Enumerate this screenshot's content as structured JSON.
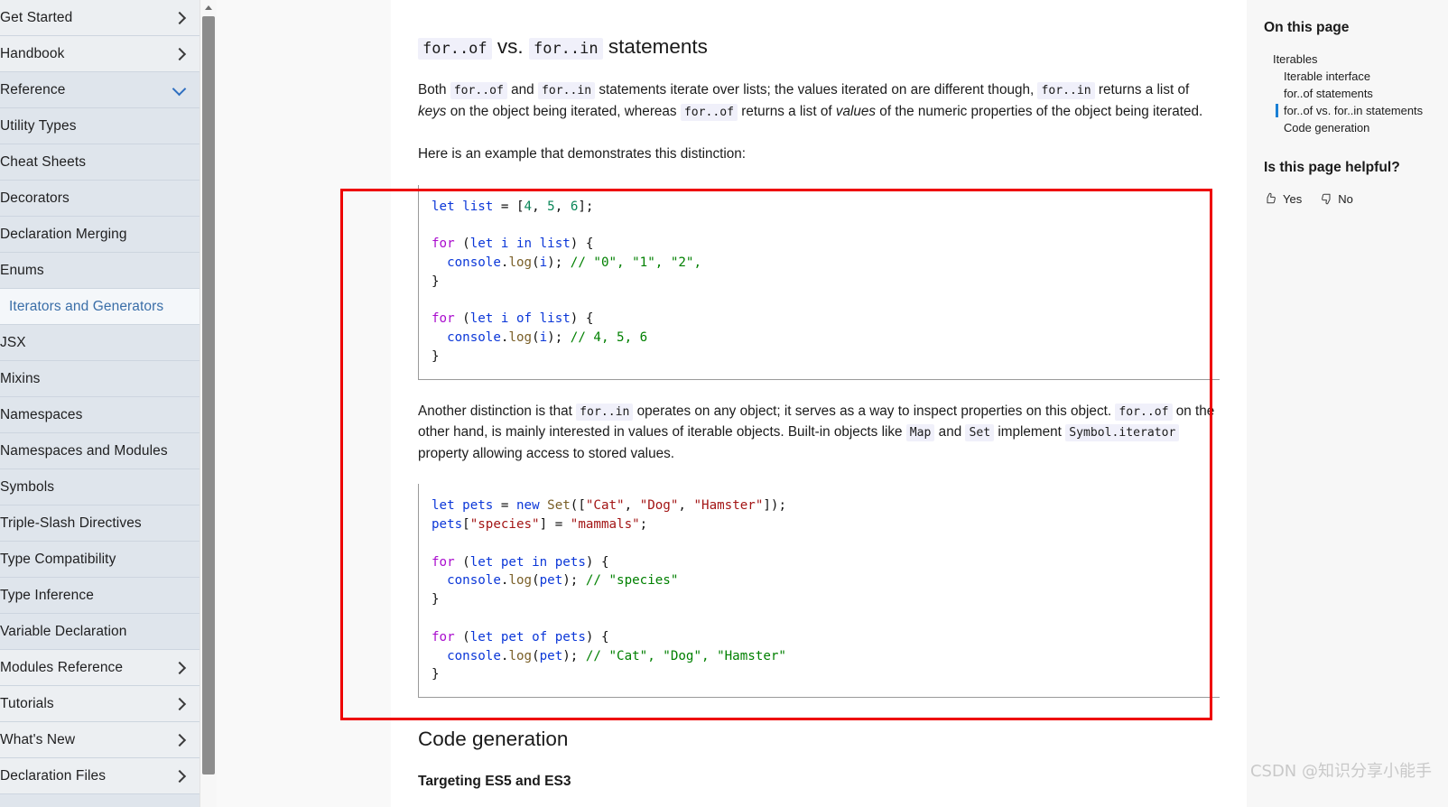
{
  "sidebar": {
    "items": [
      {
        "label": "Get Started",
        "kind": "top",
        "chevron": "right"
      },
      {
        "label": "Handbook",
        "kind": "top",
        "chevron": "right"
      },
      {
        "label": "Reference",
        "kind": "section",
        "chevron": "down"
      },
      {
        "label": "Utility Types",
        "kind": "child",
        "chevron": "none"
      },
      {
        "label": "Cheat Sheets",
        "kind": "child",
        "chevron": "none"
      },
      {
        "label": "Decorators",
        "kind": "child",
        "chevron": "none"
      },
      {
        "label": "Declaration Merging",
        "kind": "child",
        "chevron": "none"
      },
      {
        "label": "Enums",
        "kind": "child",
        "chevron": "none"
      },
      {
        "label": "Iterators and Generators",
        "kind": "active",
        "chevron": "none"
      },
      {
        "label": "JSX",
        "kind": "child",
        "chevron": "none"
      },
      {
        "label": "Mixins",
        "kind": "child",
        "chevron": "none"
      },
      {
        "label": "Namespaces",
        "kind": "child",
        "chevron": "none"
      },
      {
        "label": "Namespaces and Modules",
        "kind": "child",
        "chevron": "none"
      },
      {
        "label": "Symbols",
        "kind": "child",
        "chevron": "none"
      },
      {
        "label": "Triple-Slash Directives",
        "kind": "child",
        "chevron": "none"
      },
      {
        "label": "Type Compatibility",
        "kind": "child",
        "chevron": "none"
      },
      {
        "label": "Type Inference",
        "kind": "child",
        "chevron": "none"
      },
      {
        "label": "Variable Declaration",
        "kind": "child",
        "chevron": "none"
      },
      {
        "label": "Modules Reference",
        "kind": "top",
        "chevron": "right"
      },
      {
        "label": "Tutorials",
        "kind": "top",
        "chevron": "right"
      },
      {
        "label": "What's New",
        "kind": "top",
        "chevron": "right"
      },
      {
        "label": "Declaration Files",
        "kind": "top",
        "chevron": "right"
      }
    ]
  },
  "main": {
    "heading": {
      "code_a": "for..of",
      "vs": "vs.",
      "code_b": "for..in",
      "tail": "statements"
    },
    "para1": {
      "t1": "Both ",
      "c1": "for..of",
      "t2": " and ",
      "c2": "for..in",
      "t3": " statements iterate over lists; the values iterated on are different though, ",
      "c3": "for..in",
      "t4": " returns a list of ",
      "em1": "keys",
      "t5": " on the object being iterated, whereas ",
      "c4": "for..of",
      "t6": " returns a list of ",
      "em2": "values",
      "t7": " of the numeric properties of the object being iterated."
    },
    "para2": "Here is an example that demonstrates this distinction:",
    "code1": {
      "l1": "let list = [4, 5, 6];",
      "l2": "",
      "l3": "for (let i in list) {",
      "l4": "  console.log(i); // \"0\", \"1\", \"2\",",
      "l5": "}",
      "l6": "",
      "l7": "for (let i of list) {",
      "l8": "  console.log(i); // 4, 5, 6",
      "l9": "}"
    },
    "para3": {
      "t1": "Another distinction is that ",
      "c1": "for..in",
      "t2": " operates on any object; it serves as a way to inspect properties on this object. ",
      "c2": "for..of",
      "t3": " on the other hand, is mainly interested in values of iterable objects. Built-in objects like ",
      "c3": "Map",
      "t4": " and ",
      "c4": "Set",
      "t5": " implement ",
      "c5": "Symbol.iterator",
      "t6": " property allowing access to stored values."
    },
    "code2": {
      "l1": "let pets = new Set([\"Cat\", \"Dog\", \"Hamster\"]);",
      "l2": "pets[\"species\"] = \"mammals\";",
      "l3": "",
      "l4": "for (let pet in pets) {",
      "l5": "  console.log(pet); // \"species\"",
      "l6": "}",
      "l7": "",
      "l8": "for (let pet of pets) {",
      "l9": "  console.log(pet); // \"Cat\", \"Dog\", \"Hamster\"",
      "l10": "}"
    },
    "heading2": "Code generation",
    "subheading2": "Targeting ES5 and ES3"
  },
  "toc": {
    "title": "On this page",
    "items": [
      {
        "label": "Iterables",
        "level": 1,
        "current": false
      },
      {
        "label": "Iterable interface",
        "level": 2,
        "current": false
      },
      {
        "label": "for..of statements",
        "level": 2,
        "current": false
      },
      {
        "label": "for..of vs. for..in statements",
        "level": 2,
        "current": true
      },
      {
        "label": "Code generation",
        "level": 2,
        "current": false
      }
    ],
    "helpful_title": "Is this page helpful?",
    "yes_label": "Yes",
    "no_label": "No"
  },
  "annotation": {
    "color": "#ee0000"
  },
  "watermark": "CSDN @知识分享小能手"
}
